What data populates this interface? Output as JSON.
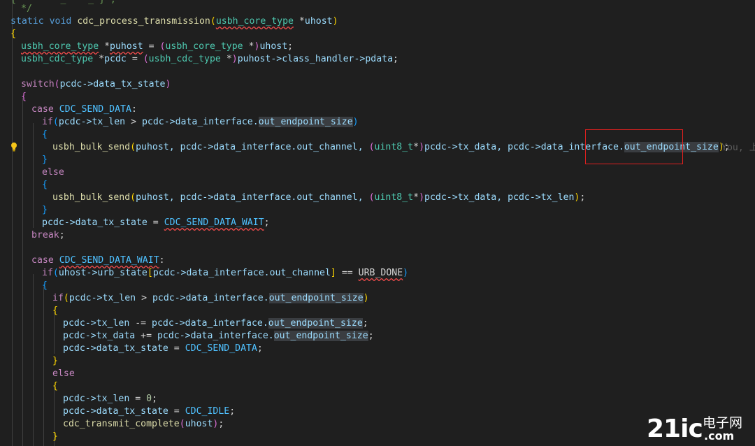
{
  "editor": {
    "language": "C",
    "theme": "dark",
    "lines": {
      "l01": {
        "comment_tail": "{        _    _ } ;"
      },
      "l02": {
        "comment_end": "*/"
      },
      "l03": {
        "kw_static": "static",
        "kw_void": "void",
        "fn_name": "cdc_process_transmission",
        "open": "(",
        "param_type": "usbh_core_type",
        "param_ptr": " *",
        "param_name": "uhost",
        "close": ")"
      },
      "l04": {
        "brace": "{"
      },
      "l05": {
        "type": "usbh_core_type",
        "mid": " *",
        "var": "puhost",
        "eq": " = ",
        "po": "(",
        "cast": "usbh_core_type",
        "star": " *",
        "pc": ")",
        "rhs": "uhost",
        "semi": ";"
      },
      "l06": {
        "type": "usbh_cdc_type",
        "mid": " *",
        "var": "pcdc",
        "eq": " = ",
        "po": "(",
        "cast": "usbh_cdc_type",
        "star": " *",
        "pc": ")",
        "rhs": "puhost->class_handler->pdata",
        "semi": ";"
      },
      "l08": {
        "kw": "switch",
        "po": "(",
        "expr": "pcdc->data_tx_state",
        "pc": ")"
      },
      "l09": {
        "brace": "{"
      },
      "l10": {
        "kw": "case",
        "label": "CDC_SEND_DATA",
        "colon": ":"
      },
      "l11": {
        "kw": "if",
        "po": "(",
        "lhs": "pcdc->tx_len",
        "op": " > ",
        "rhs": "pcdc->data_interface.",
        "field": "out_endpoint_size",
        "pc": ")"
      },
      "l12": {
        "brace": "{"
      },
      "l13": {
        "fn": "usbh_bulk_send",
        "po": "(",
        "a1": "puhost, pcdc->data_interface.out_channel, ",
        "co": "(",
        "ctype": "uint8_t",
        "cstar": "*",
        "cc": ")",
        "a2": "pcdc->tx_data, pcdc->data_interface.",
        "field": "out_endpoint_size",
        "pc": ")",
        "semi": ";"
      },
      "l14": {
        "brace": "}"
      },
      "l15": {
        "kw": "else"
      },
      "l16": {
        "brace": "{"
      },
      "l17": {
        "fn": "usbh_bulk_send",
        "po": "(",
        "a1": "puhost, pcdc->data_interface.out_channel, ",
        "co": "(",
        "ctype": "uint8_t",
        "cstar": "*",
        "cc": ")",
        "a2": "pcdc->tx_data, pcdc->tx_len",
        "pc": ")",
        "semi": ";"
      },
      "l18": {
        "brace": "}"
      },
      "l19": {
        "lhs": "pcdc->data_tx_state",
        "eq": " = ",
        "rhs": "CDC_SEND_DATA_WAIT",
        "semi": ";"
      },
      "l20": {
        "kw": "break",
        "semi": ";"
      },
      "l22": {
        "kw": "case",
        "label": "CDC_SEND_DATA_WAIT",
        "colon": ":"
      },
      "l23": {
        "kw": "if",
        "po": "(",
        "a": "uhost->urb_state",
        "bo": "[",
        "b": "pcdc->data_interface.out_channel",
        "bc": "]",
        "op": " == ",
        "c": "URB_DONE",
        "pc": ")"
      },
      "l24": {
        "brace": "{"
      },
      "l25": {
        "kw": "if",
        "po": "(",
        "lhs": "pcdc->tx_len",
        "op": " > ",
        "rhs": "pcdc->data_interface.",
        "field": "out_endpoint_size",
        "pc": ")"
      },
      "l26": {
        "brace": "{"
      },
      "l27": {
        "lhs": "pcdc->tx_len",
        "op": " -= ",
        "rhs": "pcdc->data_interface.",
        "field": "out_endpoint_size",
        "semi": ";"
      },
      "l28": {
        "lhs": "pcdc->tx_data",
        "op": " += ",
        "rhs": "pcdc->data_interface.",
        "field": "out_endpoint_size",
        "semi": ";"
      },
      "l29": {
        "lhs": "pcdc->data_tx_state",
        "eq": " = ",
        "rhs": "CDC_SEND_DATA",
        "semi": ";"
      },
      "l30": {
        "brace": "}"
      },
      "l31": {
        "kw": "else"
      },
      "l32": {
        "brace": "{"
      },
      "l33": {
        "lhs": "pcdc->tx_len",
        "eq": " = ",
        "num": "0",
        "semi": ";"
      },
      "l34": {
        "lhs": "pcdc->data_tx_state",
        "eq": " = ",
        "rhs": "CDC_IDLE",
        "semi": ";"
      },
      "l35": {
        "fn": "cdc_transmit_complete",
        "po": "(",
        "arg": "uhost",
        "pc": ")",
        "semi": ";"
      },
      "l36": {
        "brace": "}"
      }
    },
    "blame_text": "You, 上",
    "highlight_box_color": "#e0201f"
  },
  "watermark": {
    "brand": "21ic",
    "cn": "电子网",
    "domain": ".com"
  },
  "icons": {
    "lightbulb": "lightbulb-icon"
  }
}
